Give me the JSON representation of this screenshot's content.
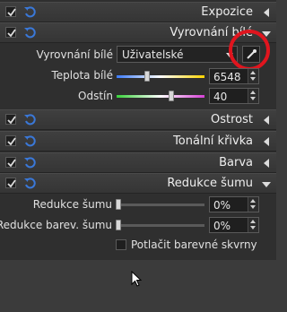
{
  "sections": {
    "expozice": "Expozice",
    "vyrovnani_bile": "Vyrovnání bílé",
    "ostrost": "Ostrost",
    "tonalni_krivka": "Tonální křivka",
    "barva": "Barva",
    "redukce_sumu": "Redukce šumu"
  },
  "white_balance": {
    "label": "Vyrovnání bílé",
    "mode": "Uživatelské",
    "temperature_label": "Teplota bílé",
    "temperature_value": "6548",
    "tint_label": "Odstín",
    "tint_value": "40"
  },
  "noise": {
    "noise_label": "Redukce šumu",
    "noise_value": "0%",
    "color_noise_label": "Redukce barev. šumu",
    "color_noise_value": "0%",
    "suppress_label": "Potlačit barevné skvrny"
  },
  "colors": {
    "highlight_ring": "#e0151e",
    "accent_blue": "#2f6fd6"
  },
  "icons": [
    "checkbox-icon",
    "reset-icon",
    "chevron-left-icon",
    "chevron-down-icon",
    "eyedropper-icon"
  ]
}
